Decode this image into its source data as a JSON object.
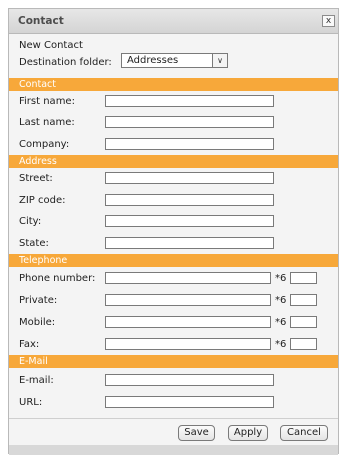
{
  "window": {
    "title": "Contact",
    "close_glyph": "x"
  },
  "header": {
    "subtitle": "New Contact",
    "destination_label": "Destination folder:",
    "destination_value": "Addresses",
    "dropdown_glyph": "∨"
  },
  "sections": {
    "contact": {
      "title": "Contact",
      "fields": [
        "First name:",
        "Last name:",
        "Company:"
      ]
    },
    "address": {
      "title": "Address",
      "fields": [
        "Street:",
        "ZIP code:",
        "City:",
        "State:"
      ]
    },
    "telephone": {
      "title": "Telephone",
      "fields": [
        "Phone number:",
        "Private:",
        "Mobile:",
        "Fax:"
      ],
      "prefix": "*6"
    },
    "email": {
      "title": "E-Mail",
      "fields": [
        "E-mail:",
        "URL:"
      ]
    }
  },
  "buttons": {
    "save": "Save",
    "apply": "Apply",
    "cancel": "Cancel"
  },
  "colors": {
    "section_header": "#f7a83a",
    "titlebar": "#dcdcdc",
    "dialog_bg": "#f4f4f4"
  },
  "icons": {
    "close": "close-icon",
    "dropdown": "chevron-down-icon"
  }
}
